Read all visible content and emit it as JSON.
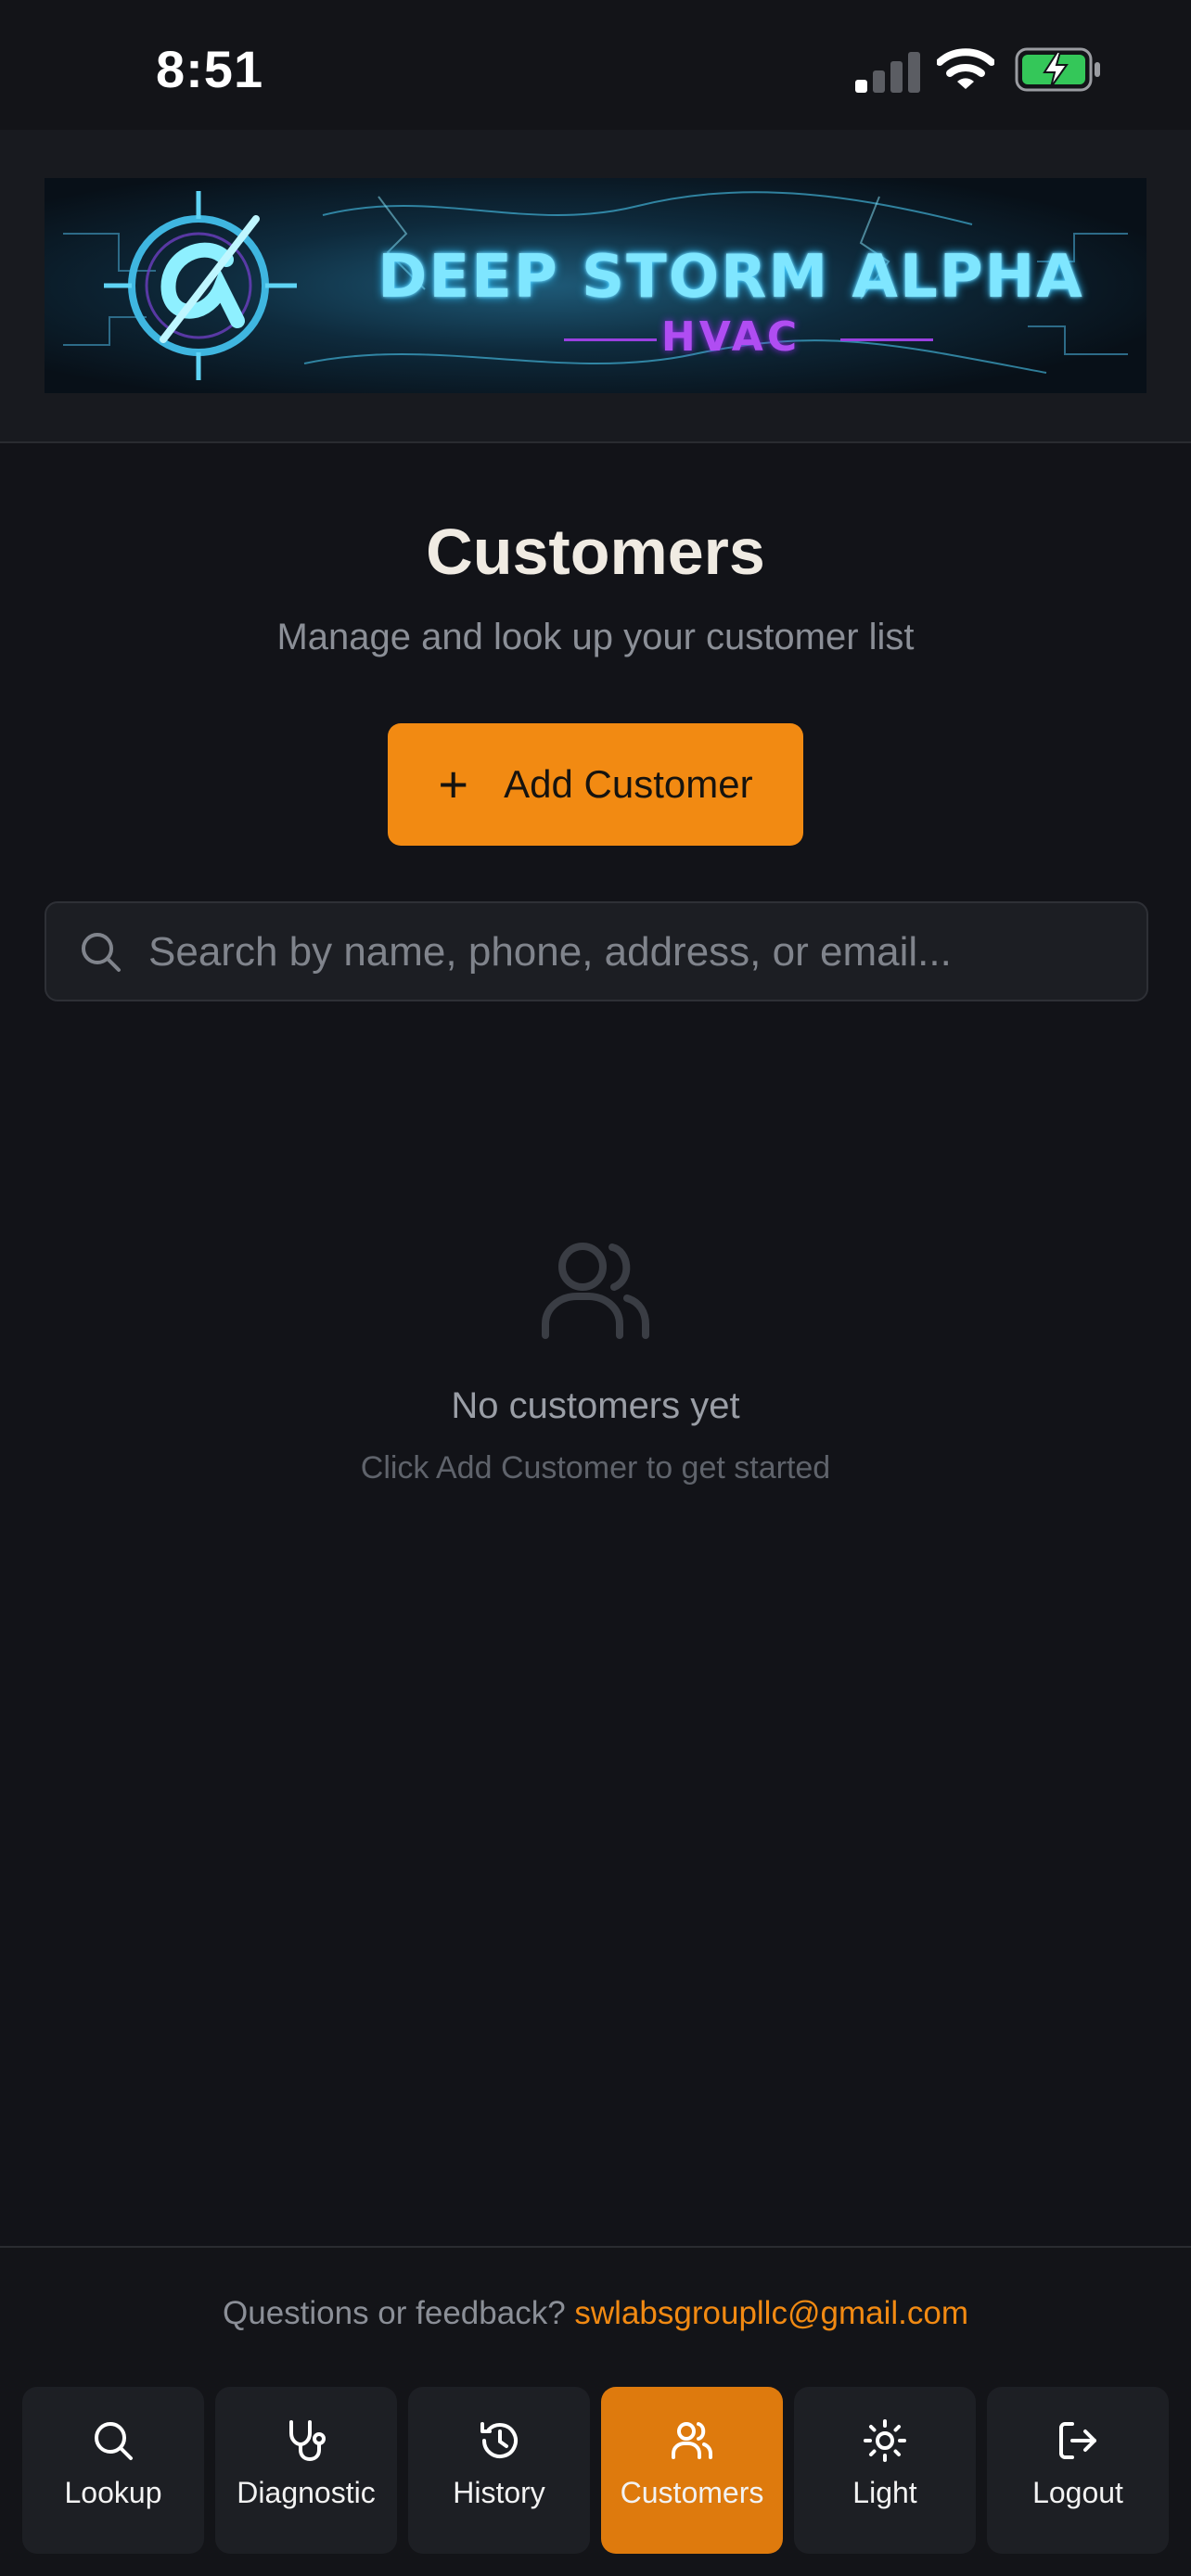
{
  "status_bar": {
    "time": "8:51"
  },
  "header": {
    "banner_title": "DEEP STORM ALPHA",
    "banner_subtitle": "HVAC"
  },
  "main": {
    "title": "Customers",
    "subtitle": "Manage and look up your customer list",
    "add_button_label": "Add Customer",
    "search_placeholder": "Search by name, phone, address, or email...",
    "empty_state": {
      "icon": "users-icon",
      "title": "No customers yet",
      "subtitle": "Click Add Customer to get started"
    }
  },
  "footer": {
    "prefix": "Questions or feedback?",
    "email": "swlabsgroupllc@gmail.com"
  },
  "nav": {
    "items": [
      {
        "label": "Lookup",
        "icon": "search-icon"
      },
      {
        "label": "Diagnostic",
        "icon": "stethoscope-icon"
      },
      {
        "label": "History",
        "icon": "history-icon"
      },
      {
        "label": "Customers",
        "icon": "users-icon",
        "active": true
      },
      {
        "label": "Light",
        "icon": "sun-icon"
      },
      {
        "label": "Logout",
        "icon": "logout-icon"
      }
    ]
  },
  "colors": {
    "accent": "#f28a12",
    "nav_active": "#de7a0d",
    "background": "#121318"
  }
}
